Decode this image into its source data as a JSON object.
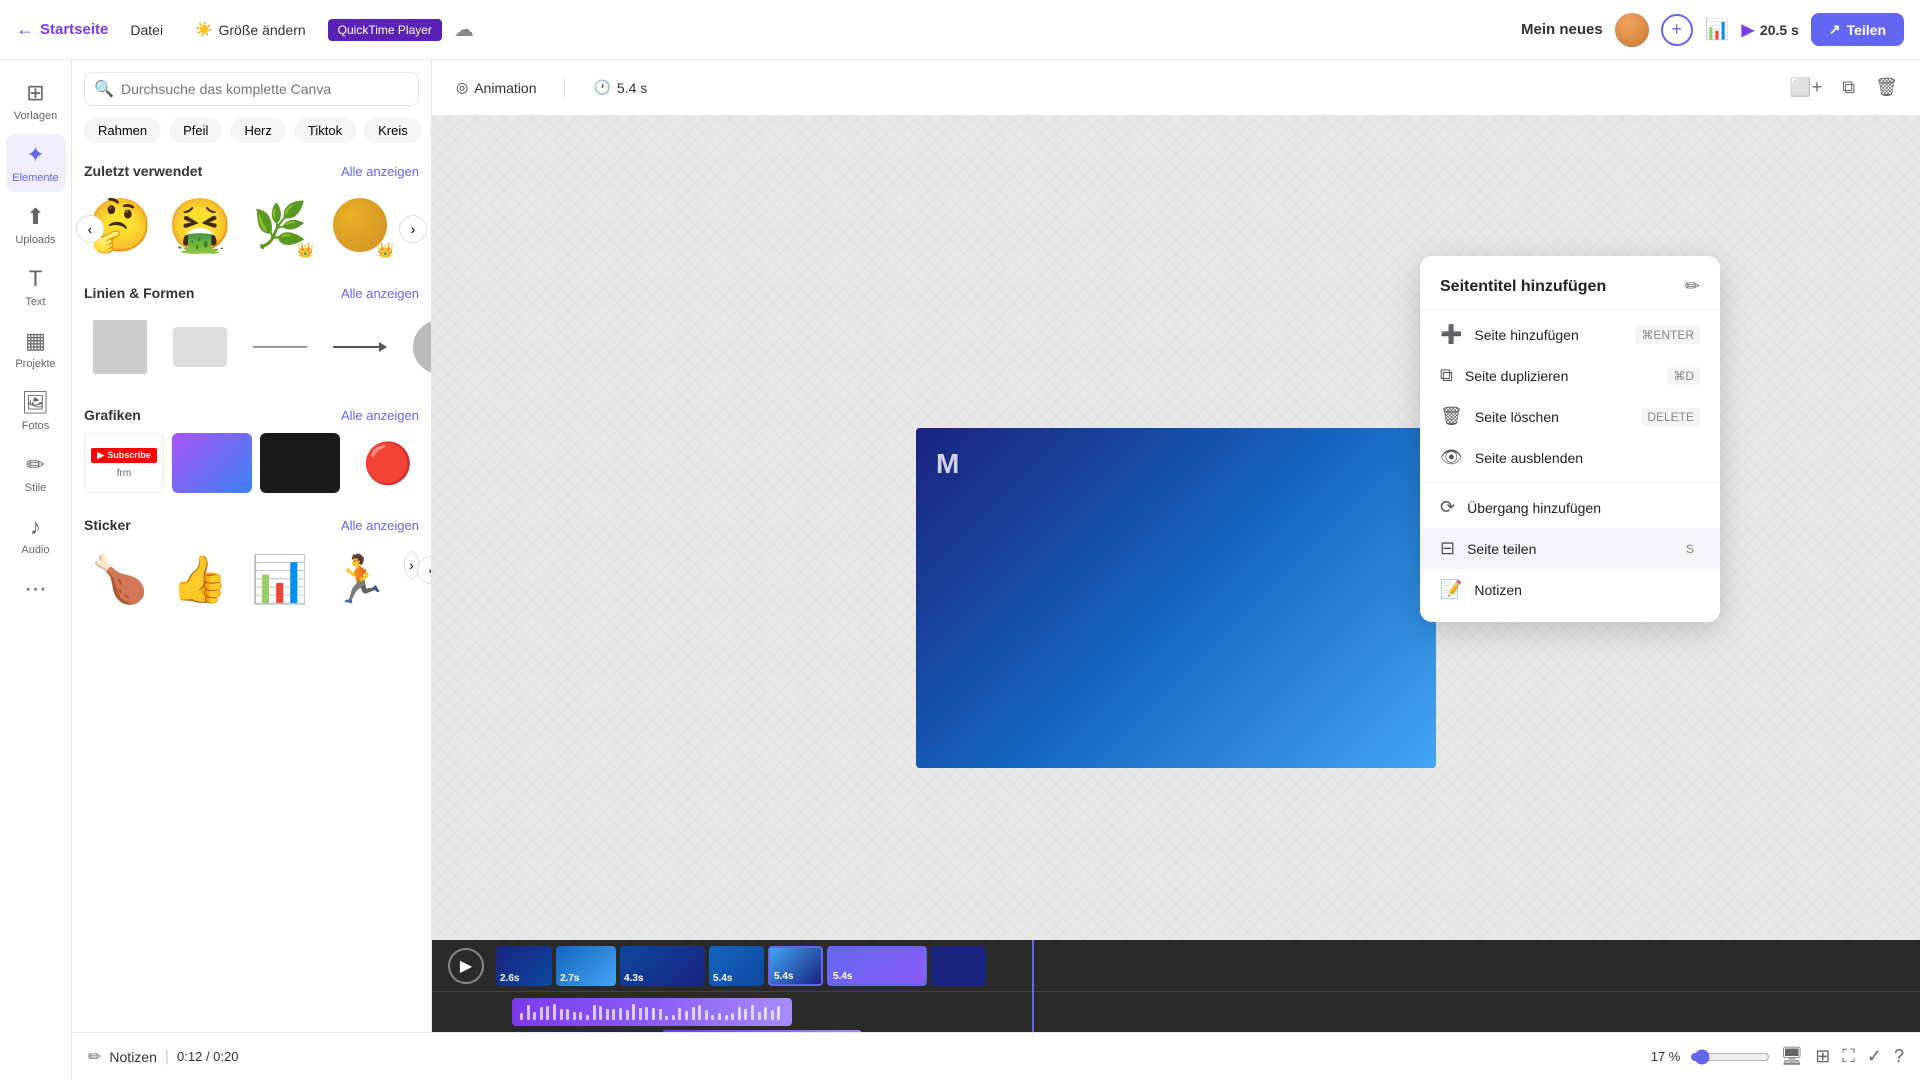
{
  "topbar": {
    "back_label": "Startseite",
    "datei_label": "Datei",
    "groesse_label": "Größe ändern",
    "quicktime_label": "QuickTime Player",
    "project_title": "Mein neues",
    "duration": "20.5 s",
    "share_label": "Teilen"
  },
  "toolbar": {
    "animation_label": "Animation",
    "duration_label": "5.4 s"
  },
  "panel": {
    "search_placeholder": "Durchsuche das komplette Canva",
    "chips": [
      "Rahmen",
      "Pfeil",
      "Herz",
      "Tiktok",
      "Kreis"
    ],
    "recently_used_title": "Zuletzt verwendet",
    "see_all_label": "Alle anzeigen",
    "lines_shapes_title": "Linien & Formen",
    "graphics_title": "Grafiken",
    "sticker_title": "Sticker",
    "sidebar_items": [
      {
        "label": "Vorlagen",
        "icon": "⊞"
      },
      {
        "label": "Elemente",
        "icon": "✦"
      },
      {
        "label": "Uploads",
        "icon": "⬆"
      },
      {
        "label": "Text",
        "icon": "T"
      },
      {
        "label": "Projekte",
        "icon": "▦"
      },
      {
        "label": "Fotos",
        "icon": "🖼"
      },
      {
        "label": "Stile",
        "icon": "✏"
      },
      {
        "label": "Audio",
        "icon": "♪"
      }
    ]
  },
  "context_menu": {
    "title": "Seitentitel hinzufügen",
    "items": [
      {
        "label": "Seite hinzufügen",
        "shortcut": "⌘ENTER",
        "icon": "➕"
      },
      {
        "label": "Seite duplizieren",
        "shortcut": "⌘D",
        "icon": "⧉"
      },
      {
        "label": "Seite löschen",
        "shortcut": "DELETE",
        "icon": "🗑"
      },
      {
        "label": "Seite ausblenden",
        "shortcut": "",
        "icon": "◎"
      },
      {
        "label": "Übergang hinzufügen",
        "shortcut": "",
        "icon": "⟳"
      },
      {
        "label": "Seite teilen",
        "shortcut": "S",
        "icon": "⊟"
      },
      {
        "label": "Notizen",
        "shortcut": "",
        "icon": "📝"
      }
    ]
  },
  "timeline": {
    "play_icon": "▶",
    "time_display": "0:12 / 0:20",
    "notes_label": "Notizen"
  },
  "status_bar": {
    "notes_label": "Notizen",
    "time": "0:12 / 0:20",
    "zoom": "17 %"
  },
  "slide_durations": [
    "2.6s",
    "2.7s",
    "4.3s",
    "5.4s",
    "5.4s",
    "5.4s"
  ]
}
